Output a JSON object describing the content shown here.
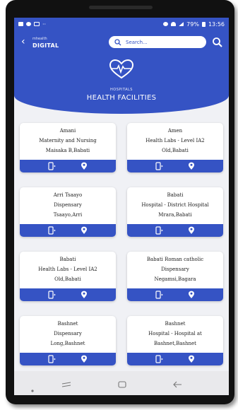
{
  "status_bar": {
    "battery": "79%",
    "time": "13:56"
  },
  "header": {
    "brand_small": "mhealth",
    "brand_big": "DIGITAL",
    "search_placeholder": "Search..."
  },
  "hero": {
    "subtitle": "HOSPITALS",
    "title": "HEALTH FACILITIES"
  },
  "facilities": [
    {
      "line1": "Amani",
      "line2": "Maternity and Nursing",
      "line3": "Maisaka B,Babati"
    },
    {
      "line1": "Amen",
      "line2": "Health Labs - Level IA2",
      "line3": "Old,Babati"
    },
    {
      "line1": "Arri Tsaayo",
      "line2": "Dispensary",
      "line3": "Tsaayo,Arri"
    },
    {
      "line1": "Babati",
      "line2": "Hospital - District Hospital",
      "line3": "Mrara,Babati"
    },
    {
      "line1": "Babati",
      "line2": "Health Labs - Level IA2",
      "line3": "Old,Babati"
    },
    {
      "line1": "Babati Roman catholic",
      "line2": "Dispensary",
      "line3": "Negamsi,Bagara"
    },
    {
      "line1": "Bashnet",
      "line2": "Dispensary",
      "line3": "Long,Bashnet"
    },
    {
      "line1": "Bashnet",
      "line2": "Hospital - Hospital at",
      "line3": "Bashnet,Bashnet"
    }
  ],
  "colors": {
    "primary": "#3553c4",
    "background": "#f0f1f5"
  },
  "icons": {
    "card_actions": [
      "call-icon",
      "location-pin-icon"
    ],
    "nav": [
      "recent-apps-icon",
      "home-icon",
      "back-nav-icon"
    ]
  }
}
